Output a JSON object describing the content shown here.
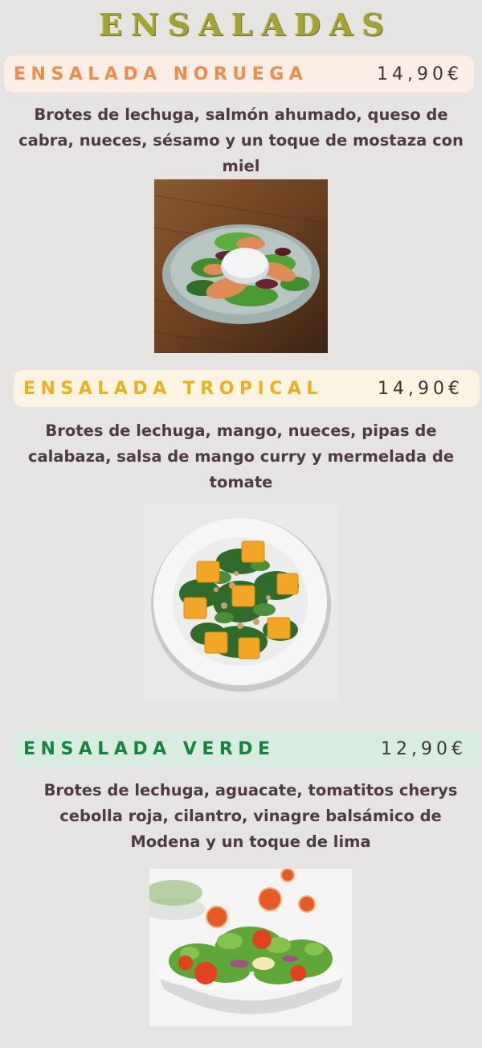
{
  "title": "ENSALADAS",
  "items": [
    {
      "name": "ENSALADA NORUEGA",
      "price": "14,90€",
      "description_lines": [
        "Brotes de lechuga, salmón ahumado, queso de",
        "cabra, nueces, sésamo y un toque de mostaza con",
        "miel"
      ],
      "name_color": "#ef8c4c",
      "bar_color": "#fbeee6",
      "image": "salmon-goat-cheese-salad-photo"
    },
    {
      "name": "ENSALADA TROPICAL",
      "price": "14,90€",
      "description_lines": [
        "Brotes de lechuga, mango, nueces, pipas de",
        "calabaza, salsa de mango curry y mermelada de",
        "tomate"
      ],
      "name_color": "#e9b21c",
      "bar_color": "#fbf4e3",
      "image": "mango-salad-photo"
    },
    {
      "name": "ENSALADA VERDE",
      "price": "12,90€",
      "description_lines": [
        "Brotes de lechuga, aguacate, tomatitos cherys",
        "cebolla roja, cilantro, vinagre balsámico de",
        "Modena  y un toque de lima"
      ],
      "name_color": "#16843f",
      "bar_color": "#d8ede0",
      "image": "green-salad-tomatoes-photo"
    }
  ]
}
